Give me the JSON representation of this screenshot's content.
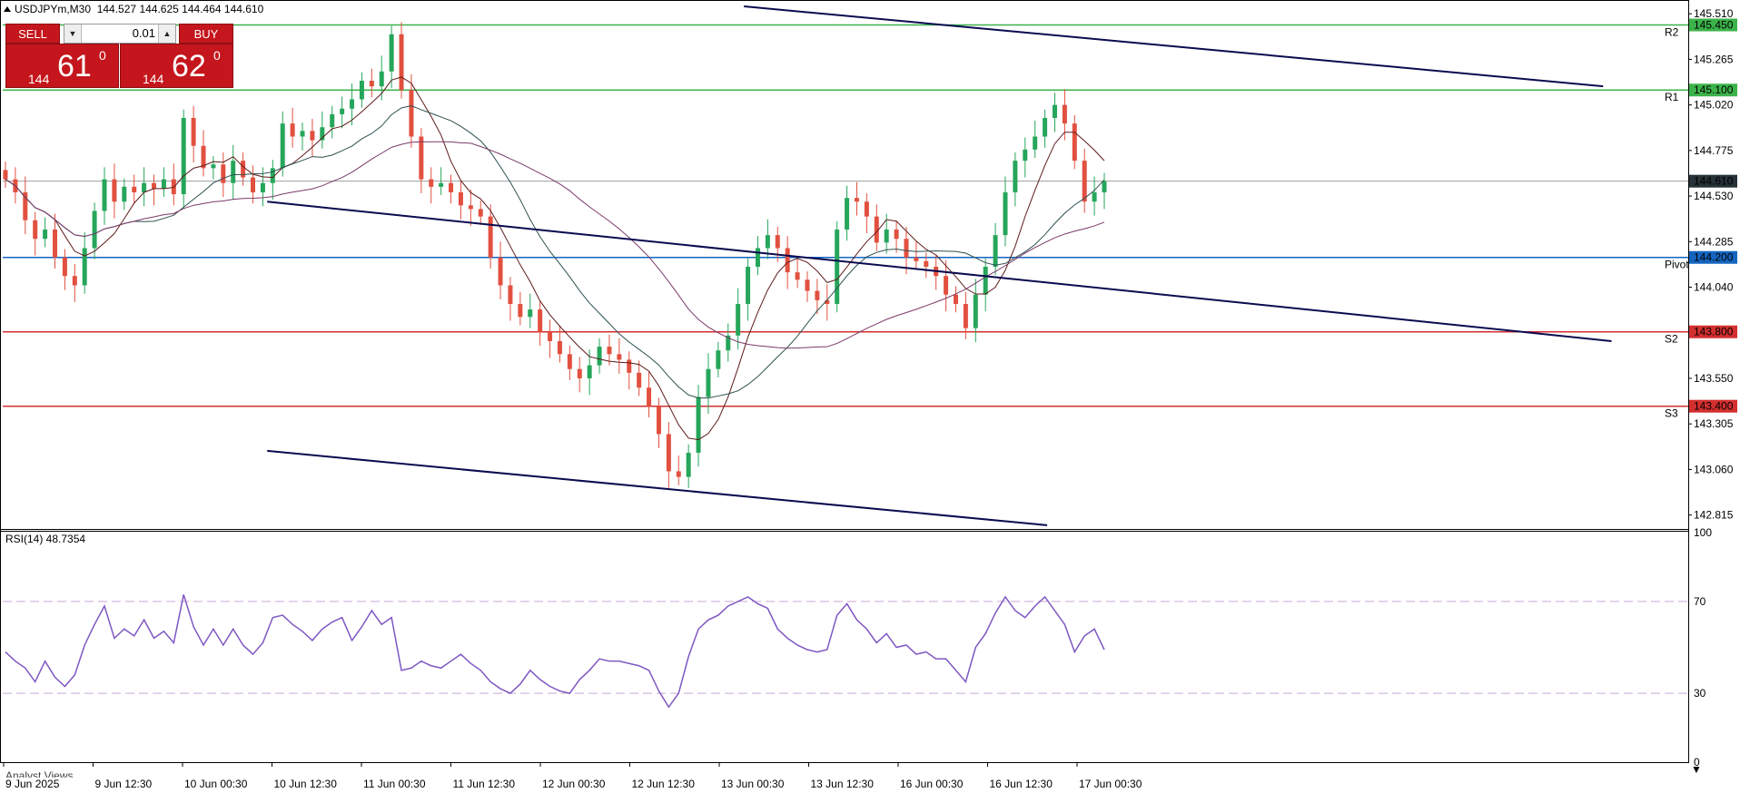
{
  "header": {
    "symbol": "USDJPYm,M30",
    "open": "144.527",
    "high": "144.625",
    "low": "144.464",
    "close": "144.610"
  },
  "trade_panel": {
    "sell_label": "SELL",
    "buy_label": "BUY",
    "lot": "0.01",
    "sell_prefix": "144",
    "sell_big": "61",
    "sell_frac": "0",
    "buy_prefix": "144",
    "buy_big": "62",
    "buy_frac": "0"
  },
  "indicator_label": "RSI(14) 48.7354",
  "bottom_tab": "Analyst Views",
  "colors": {
    "bull": "#26a65b",
    "bear": "#e2503f",
    "resistance": "#3cb34a",
    "pivot": "#1565c0",
    "support": "#d32f2f",
    "trend": "#0a0a50",
    "rsi": "#7e57c2",
    "current": "#263238"
  },
  "chart_data": {
    "type": "candlestick",
    "price_axis": {
      "range": [
        142.74,
        145.55
      ],
      "ticks": [
        "145.510",
        "145.265",
        "145.020",
        "144.775",
        "144.530",
        "144.285",
        "144.040",
        "143.550",
        "143.305",
        "143.060",
        "142.815"
      ]
    },
    "time_axis": {
      "labels": [
        "9 Jun 2025",
        "9 Jun 12:30",
        "10 Jun 00:30",
        "10 Jun 12:30",
        "11 Jun 00:30",
        "11 Jun 12:30",
        "12 Jun 00:30",
        "12 Jun 12:30",
        "13 Jun 00:30",
        "13 Jun 12:30",
        "16 Jun 00:30",
        "16 Jun 12:30",
        "17 Jun 00:30"
      ]
    },
    "levels": [
      {
        "price": 145.45,
        "label": "145.450",
        "tag": "R2",
        "kind": "resistance"
      },
      {
        "price": 145.1,
        "label": "145.100",
        "tag": "R1",
        "kind": "resistance"
      },
      {
        "price": 144.2,
        "label": "144.200",
        "tag": "Pivot",
        "kind": "pivot"
      },
      {
        "price": 143.8,
        "label": "143.800",
        "tag": "S2",
        "kind": "support"
      },
      {
        "price": 143.4,
        "label": "143.400",
        "tag": "S3",
        "kind": "support"
      }
    ],
    "current_price": {
      "price": 144.61,
      "label": "144.610"
    },
    "trendlines": [
      {
        "x1": 0.44,
        "y1": 145.55,
        "x2": 0.95,
        "y2": 145.12
      },
      {
        "x1": 0.157,
        "y1": 144.5,
        "x2": 0.955,
        "y2": 143.75
      },
      {
        "x1": 0.157,
        "y1": 143.16,
        "x2": 0.62,
        "y2": 142.76
      }
    ],
    "closes": [
      144.62,
      144.55,
      144.4,
      144.3,
      144.35,
      144.2,
      144.1,
      144.05,
      144.25,
      144.45,
      144.62,
      144.5,
      144.58,
      144.55,
      144.6,
      144.57,
      144.62,
      144.54,
      144.95,
      144.8,
      144.68,
      144.7,
      144.6,
      144.72,
      144.63,
      144.55,
      144.6,
      144.68,
      144.92,
      144.85,
      144.88,
      144.83,
      144.9,
      144.97,
      145.0,
      145.05,
      145.15,
      145.12,
      145.2,
      145.4,
      145.1,
      144.85,
      144.62,
      144.58,
      144.6,
      144.55,
      144.48,
      144.46,
      144.42,
      144.2,
      144.05,
      143.95,
      143.88,
      143.92,
      143.8,
      143.75,
      143.68,
      143.6,
      143.55,
      143.62,
      143.72,
      143.68,
      143.65,
      143.58,
      143.5,
      143.4,
      143.25,
      143.05,
      143.02,
      143.15,
      143.45,
      143.6,
      143.7,
      143.78,
      143.95,
      144.15,
      144.25,
      144.32,
      144.25,
      144.12,
      144.08,
      144.02,
      143.97,
      143.95,
      144.35,
      144.52,
      144.5,
      144.42,
      144.28,
      144.35,
      144.3,
      144.2,
      144.18,
      144.15,
      144.1,
      144.0,
      143.95,
      143.82,
      144.0,
      144.15,
      144.32,
      144.55,
      144.72,
      144.78,
      144.85,
      144.95,
      145.02,
      144.92,
      144.72,
      144.5,
      144.55,
      144.61
    ],
    "rsi": {
      "range": [
        0,
        100
      ],
      "levels": [
        70,
        30
      ],
      "ticks": [
        "100",
        "70",
        "30",
        "0"
      ],
      "values": [
        48,
        44,
        41,
        35,
        44,
        37,
        33,
        38,
        51,
        60,
        68,
        54,
        58,
        55,
        62,
        54,
        57,
        52,
        73,
        59,
        51,
        58,
        51,
        58,
        51,
        47,
        52,
        63,
        64,
        60,
        57,
        53,
        58,
        61,
        63,
        53,
        59,
        66,
        60,
        63,
        40,
        41,
        44,
        42,
        41,
        44,
        47,
        43,
        40,
        35,
        32,
        30,
        34,
        40,
        36,
        33,
        31,
        30,
        36,
        40,
        45,
        44,
        44,
        43,
        42,
        40,
        31,
        24,
        30,
        46,
        58,
        62,
        64,
        68,
        70,
        72,
        69,
        67,
        58,
        54,
        51,
        49,
        48,
        49,
        64,
        69,
        62,
        58,
        52,
        56,
        50,
        51,
        47,
        48,
        45,
        45,
        40,
        35,
        50,
        56,
        65,
        72,
        66,
        63,
        68,
        72,
        66,
        60,
        48,
        55,
        58,
        49
      ]
    }
  }
}
